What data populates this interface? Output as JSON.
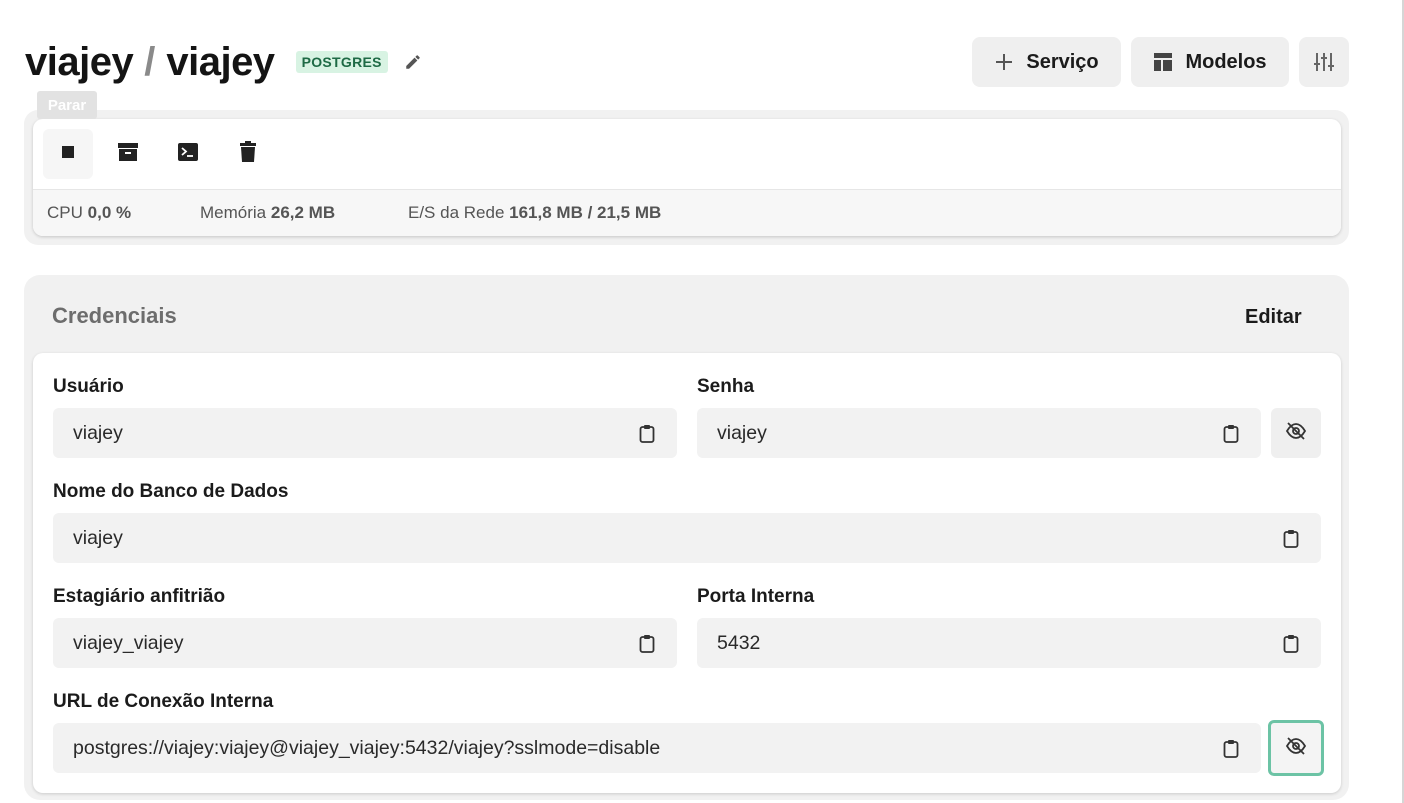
{
  "header": {
    "project": "viajey",
    "separator": "/",
    "service": "viajey",
    "badge": "POSTGRES",
    "buttons": {
      "add_service": "Serviço",
      "templates": "Modelos"
    }
  },
  "tooltip": "Parar",
  "stats": {
    "cpu_label": "CPU",
    "cpu_value": "0,0 %",
    "mem_label": "Memória",
    "mem_value": "26,2 MB",
    "net_label": "E/S da Rede",
    "net_value": "161,8 MB / 21,5 MB"
  },
  "credentials": {
    "title": "Credenciais",
    "edit_label": "Editar",
    "user": {
      "label": "Usuário",
      "value": "viajey"
    },
    "password": {
      "label": "Senha",
      "value": "viajey"
    },
    "database": {
      "label": "Nome do Banco de Dados",
      "value": "viajey"
    },
    "host": {
      "label": "Estagiário anfitrião",
      "value": "viajey_viajey"
    },
    "port": {
      "label": "Porta Interna",
      "value": "5432"
    },
    "url": {
      "label": "URL de Conexão Interna",
      "value": "postgres://viajey:viajey@viajey_viajey:5432/viajey?sslmode=disable"
    }
  },
  "colors": {
    "badge_bg": "#d8f3e3",
    "badge_text": "#1e6a45",
    "focus_ring": "#6cc3a5"
  },
  "icons": [
    "pencil-icon",
    "plus-icon",
    "template-icon",
    "sliders-icon",
    "stop-icon",
    "archive-icon",
    "terminal-icon",
    "trash-icon",
    "clipboard-icon",
    "eye-off-icon"
  ]
}
